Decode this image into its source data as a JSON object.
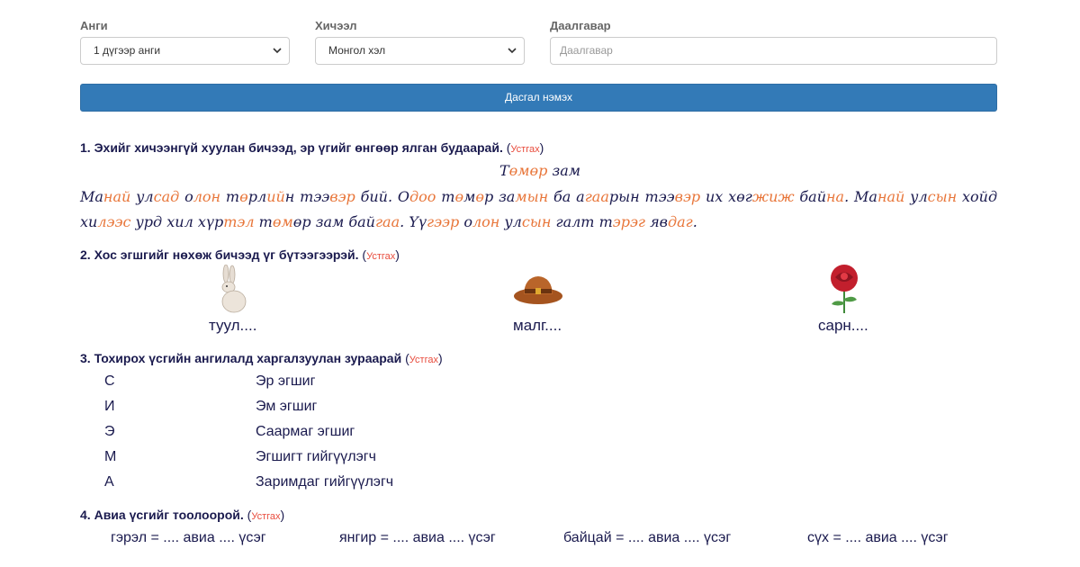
{
  "filters": {
    "grade_label": "Анги",
    "grade_value": "1 дүгээр анги",
    "subject_label": "Хичээл",
    "subject_value": "Монгол хэл",
    "task_label": "Даалгавар",
    "task_placeholder": "Даалгавар"
  },
  "add_button": "Дасгал нэмэх",
  "delete_label": "Устгах",
  "questions": [
    {
      "number": "1.",
      "title": "Эхийг хичээнгүй хуулан бичээд, эр үгийг өнгөөр ялган будаарай."
    },
    {
      "number": "2.",
      "title": "Хос эгшгийг нөхөж бичээд үг бүтээгээрэй."
    },
    {
      "number": "3.",
      "title": "Тохирох үсгийн ангилалд харгалзуулан зураарай"
    },
    {
      "number": "4.",
      "title": "Авиа үсгийг тоолоорой."
    }
  ],
  "story": {
    "title_a": "Т",
    "title_b": "өмөр",
    "title_c": " зам"
  },
  "pictures": [
    {
      "label": "туул....",
      "icon": "rabbit-icon"
    },
    {
      "label": "малг....",
      "icon": "hat-icon"
    },
    {
      "label": "сарн....",
      "icon": "rose-icon"
    }
  ],
  "letters": [
    "С",
    "И",
    "Э",
    "М",
    "А"
  ],
  "categories": [
    "Эр эгшиг",
    "Эм эгшиг",
    "Саармаг эгшиг",
    "Эгшигт гийгүүлэгч",
    "Заримдаг гийгүүлэгч"
  ],
  "sounds": [
    "гэрэл = .... авиа .... үсэг",
    "янгир = .... авиа .... үсэг",
    "байцай = .... авиа .... үсэг",
    "сүх = .... авиа .... үсэг"
  ],
  "colors": {
    "accent": "#337ab7",
    "highlight": "#e8763a",
    "delete": "#e84c3d",
    "text": "#1a1a4e"
  }
}
